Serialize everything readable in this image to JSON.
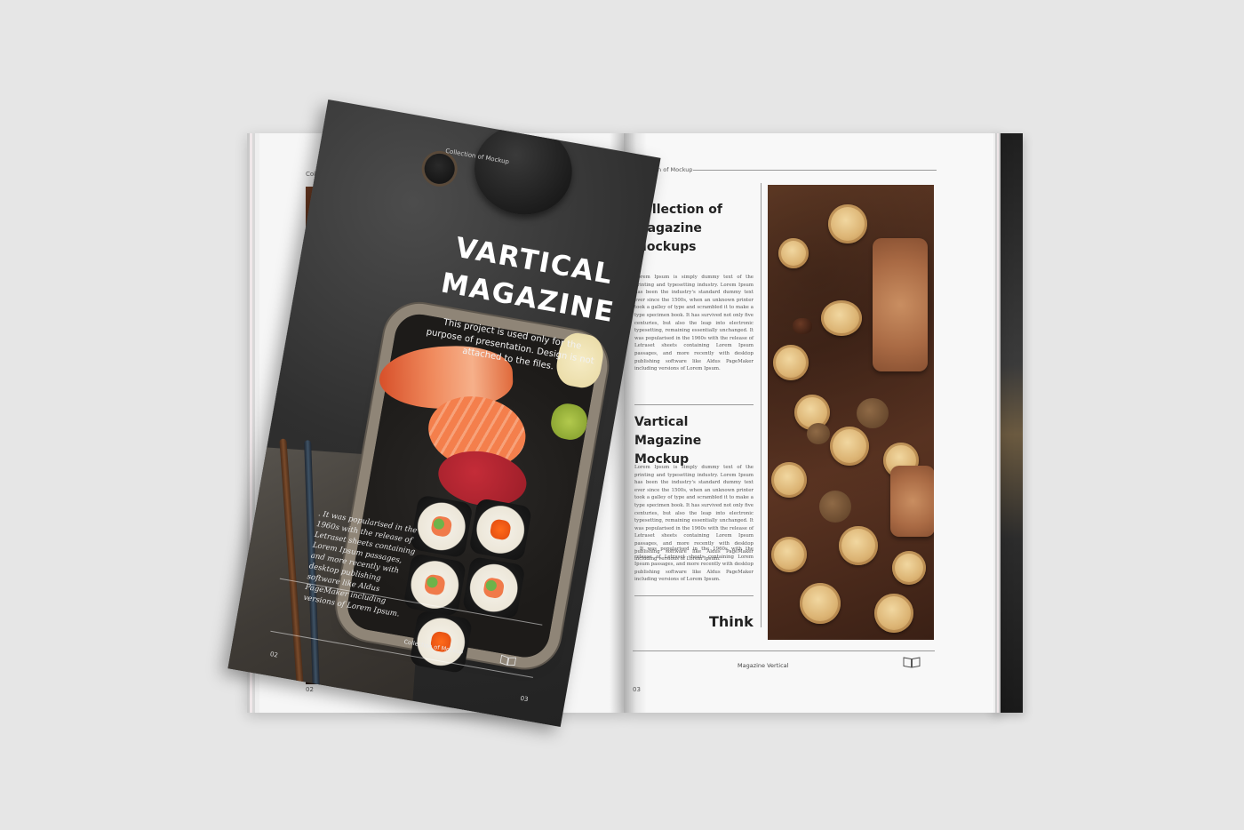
{
  "left_page": {
    "running_head": "Collection o",
    "page_number": "02"
  },
  "cover": {
    "meta": "Collection of Mockup",
    "title": "Vartical Magazine",
    "subtitle": "This project is used only for the purpose of presentation. Design is not attached to the files.",
    "quote": ". It was popularised in the 1960s with the release of Letraset sheets containing Lorem Ipsum passages, and more recently with desktop publishing software like Aldus PageMaker including versions of Lorem Ipsum.",
    "footer": "Collection of Mockup",
    "page_left": "02",
    "page_right": "03",
    "book_icon": "book-icon"
  },
  "right_page": {
    "header": "Collection of Mockup",
    "heading_1": "Collection of magazine Mockups",
    "body_1": "Lorem Ipsum is simply dummy text of the printing and typesetting industry. Lorem Ipsum has been the industry's standard dummy text ever since the 1500s, when an unknown printer took a galley of type and scrambled it to make a type specimen book. It has survived not only five centuries, but also the leap into electronic typesetting, remaining essentially unchanged. It was popularised in the 1960s with the release of Letraset sheets containing Lorem Ipsum passages, and more recently with desktop publishing software like Aldus PageMaker including versions of Lorem Ipsum.",
    "heading_2": "Vartical Magazine Mockup",
    "body_2": "Lorem Ipsum is simply dummy text of the printing and typesetting industry. Lorem Ipsum has been the industry's standard dummy text ever since the 1500s, when an unknown printer took a galley of type and scrambled it to make a type specimen book. It has survived not only five centuries, but also the leap into electronic typesetting, remaining essentially unchanged. It was popularised in the 1960s with the release of Letraset sheets containing Lorem Ipsum passages, and more recently with desktop publishing software like Aldus PageMaker including versions of Lorem Ipsum.",
    "body_3": ". It was popularised in the 1960s with the release of Letraset sheets containing Lorem Ipsum passages, and more recently with desktop publishing software like Aldus PageMaker including versions of Lorem Ipsum.",
    "pull_word": "Think",
    "footer": "Magazine Vertical",
    "page_number": "03",
    "book_icon": "book-icon"
  }
}
